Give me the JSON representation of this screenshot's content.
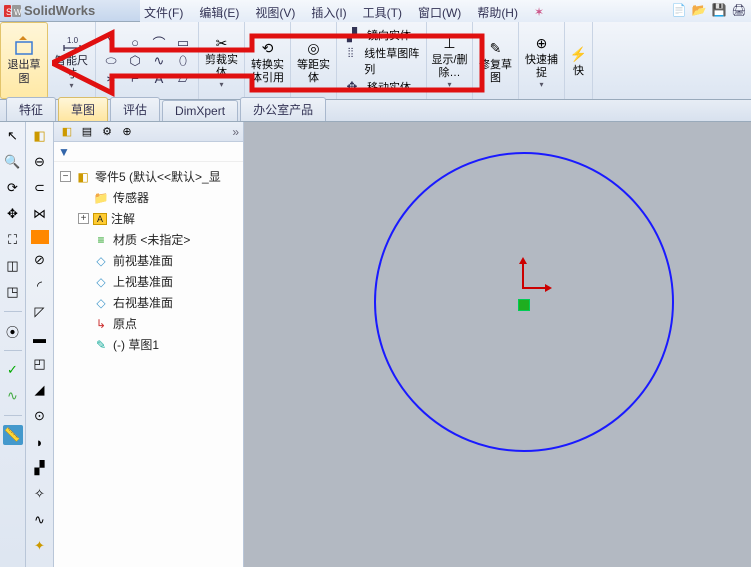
{
  "app": {
    "title": "SolidWorks"
  },
  "menu": {
    "file": "文件(F)",
    "edit": "编辑(E)",
    "view": "视图(V)",
    "insert": "插入(I)",
    "tools": "工具(T)",
    "window": "窗口(W)",
    "help": "帮助(H)"
  },
  "ribbon": {
    "exit_sketch": "退出草图",
    "smart_dim": "智能尺寸",
    "trim": "剪裁实体",
    "convert": "转换实体引用",
    "offset": "等距实体",
    "mirror": "镜向实体",
    "linear_pattern": "线性草图阵列",
    "move": "移动实体",
    "display_delete": "显示/删除…",
    "repair_sketch": "修复草图",
    "quick_snap": "快速捕捉",
    "quick": "快"
  },
  "tabs": {
    "feature": "特征",
    "sketch": "草图",
    "evaluate": "评估",
    "dimxpert": "DimXpert",
    "office": "办公室产品"
  },
  "tree": {
    "part": "零件5  (默认<<默认>_显",
    "sensors": "传感器",
    "annotations": "注解",
    "material": "材质 <未指定>",
    "front_plane": "前视基准面",
    "top_plane": "上视基准面",
    "right_plane": "右视基准面",
    "origin": "原点",
    "sketch1": "(-) 草图1"
  }
}
